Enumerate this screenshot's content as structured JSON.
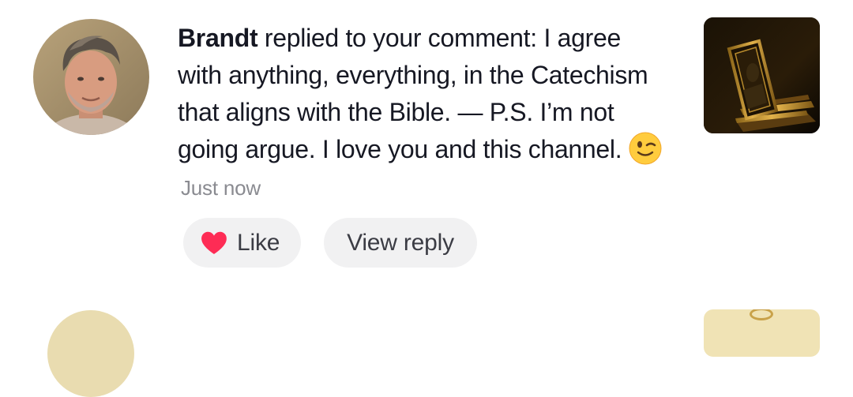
{
  "notification": {
    "username": "Brandt",
    "message": " replied to your comment: I agree with anything, everything, in the Catechism that aligns with the Bible. — P.S. I’m not going argue. I love you and this channel. ",
    "emoji_icon": "winking-face-icon",
    "timestamp": "Just now",
    "actions": {
      "like_label": "Like",
      "like_icon": "heart-icon",
      "view_reply_label": "View reply"
    }
  },
  "colors": {
    "text_primary": "#161823",
    "text_secondary": "#8a8b91",
    "pill_background": "#f1f1f2",
    "heart": "#fe2c55"
  }
}
